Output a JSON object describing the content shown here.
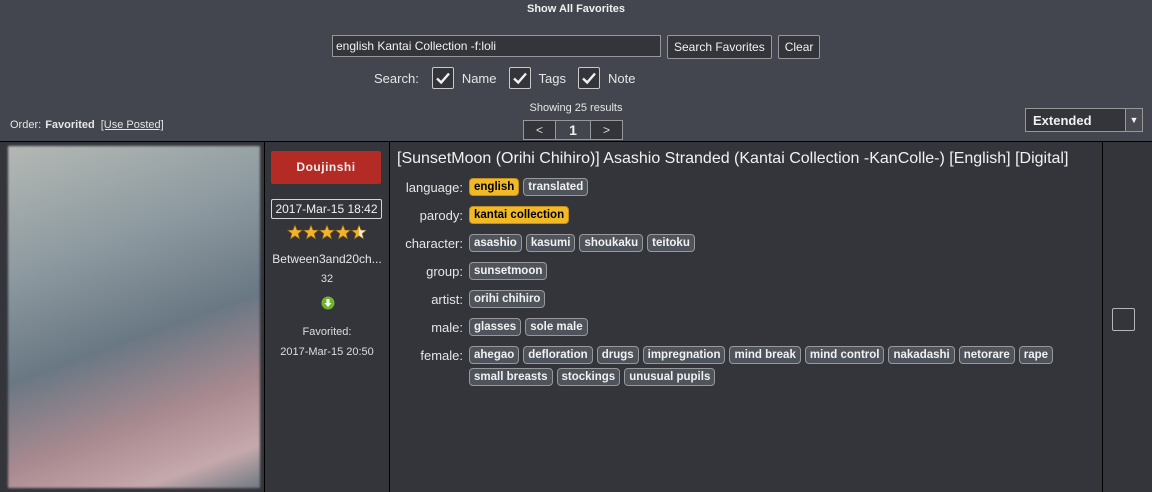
{
  "header": {
    "title": "Show All Favorites"
  },
  "search": {
    "value": "english Kantai Collection -f:loli",
    "submit_label": "Search Favorites",
    "clear_label": "Clear",
    "options_label": "Search:",
    "options": [
      {
        "label": "Name",
        "checked": true
      },
      {
        "label": "Tags",
        "checked": true
      },
      {
        "label": "Note",
        "checked": true
      }
    ]
  },
  "order": {
    "label": "Order:",
    "current": "Favorited",
    "alt_link": "[Use Posted]"
  },
  "results": {
    "text": "Showing 25 results"
  },
  "pager": {
    "prev": "<",
    "current": "1",
    "next": ">"
  },
  "view_select": {
    "value": "Extended"
  },
  "gallery": {
    "category": "Doujinshi",
    "category_color": "#b42a24",
    "posted": "2017-Mar-15 18:42",
    "rating": 4.5,
    "uploader": "Between3and20ch...",
    "pages": "32",
    "favorited_label": "Favorited:",
    "favorited_date": "2017-Mar-15 20:50",
    "title": "[SunsetMoon (Orihi Chihiro)] Asashio Stranded (Kantai Collection -KanColle-) [English] [Digital]",
    "highlight_color": "#f1b925",
    "tag_groups": [
      {
        "ns": "language:",
        "tags": [
          {
            "t": "english",
            "hl": true
          },
          {
            "t": "translated"
          }
        ]
      },
      {
        "ns": "parody:",
        "tags": [
          {
            "t": "kantai collection",
            "hl": true
          }
        ]
      },
      {
        "ns": "character:",
        "tags": [
          {
            "t": "asashio"
          },
          {
            "t": "kasumi"
          },
          {
            "t": "shoukaku"
          },
          {
            "t": "teitoku"
          }
        ]
      },
      {
        "ns": "group:",
        "tags": [
          {
            "t": "sunsetmoon"
          }
        ]
      },
      {
        "ns": "artist:",
        "tags": [
          {
            "t": "orihi chihiro"
          }
        ]
      },
      {
        "ns": "male:",
        "tags": [
          {
            "t": "glasses"
          },
          {
            "t": "sole male"
          }
        ]
      },
      {
        "ns": "female:",
        "tags": [
          {
            "t": "ahegao"
          },
          {
            "t": "defloration"
          },
          {
            "t": "drugs"
          },
          {
            "t": "impregnation"
          },
          {
            "t": "mind break"
          },
          {
            "t": "mind control"
          },
          {
            "t": "nakadashi"
          },
          {
            "t": "netorare"
          },
          {
            "t": "rape"
          },
          {
            "t": "small breasts"
          },
          {
            "t": "stockings"
          },
          {
            "t": "unusual pupils"
          }
        ]
      }
    ]
  }
}
